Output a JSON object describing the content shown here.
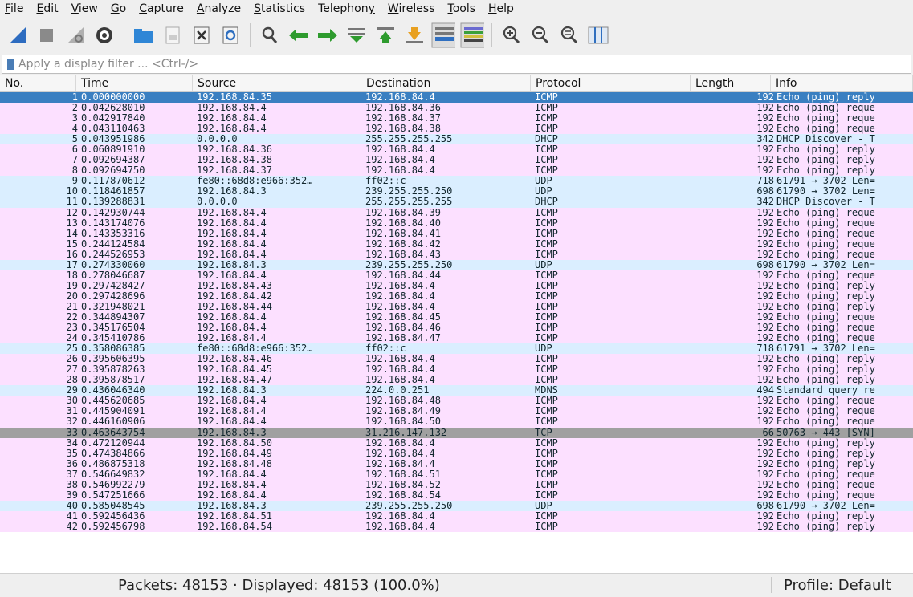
{
  "menu": [
    "File",
    "Edit",
    "View",
    "Go",
    "Capture",
    "Analyze",
    "Statistics",
    "Telephony",
    "Wireless",
    "Tools",
    "Help"
  ],
  "toolbar_icons": [
    "shark-fin-start-icon",
    "stop-square-icon",
    "restart-fin-icon",
    "gear-options-icon",
    "open-folder-icon",
    "file-icon",
    "close-file-icon",
    "reload-icon",
    "search-icon",
    "arrow-back-icon",
    "arrow-forward-icon",
    "go-to-packet-icon",
    "first-packet-icon",
    "last-packet-icon",
    "autoscroll-icon",
    "colorize-icon",
    "zoom-in-icon",
    "zoom-out-icon",
    "zoom-normal-icon",
    "resize-columns-icon"
  ],
  "filter": {
    "placeholder": "Apply a display filter ... <Ctrl-/>"
  },
  "columns": [
    "No.",
    "Time",
    "Source",
    "Destination",
    "Protocol",
    "Length",
    "Info"
  ],
  "colors": {
    "icmp": "#fce0ff",
    "udp": "#daeeff",
    "tcp": "#a0a0a0",
    "selected": "#3a7fc1"
  },
  "packets": [
    [
      "1",
      "0.000000000",
      "192.168.84.35",
      "192.168.84.4",
      "ICMP",
      "192",
      "Echo (ping) reply"
    ],
    [
      "2",
      "0.042628010",
      "192.168.84.4",
      "192.168.84.36",
      "ICMP",
      "192",
      "Echo (ping) reque"
    ],
    [
      "3",
      "0.042917840",
      "192.168.84.4",
      "192.168.84.37",
      "ICMP",
      "192",
      "Echo (ping) reque"
    ],
    [
      "4",
      "0.043110463",
      "192.168.84.4",
      "192.168.84.38",
      "ICMP",
      "192",
      "Echo (ping) reque"
    ],
    [
      "5",
      "0.043951986",
      "0.0.0.0",
      "255.255.255.255",
      "DHCP",
      "342",
      "DHCP Discover - T"
    ],
    [
      "6",
      "0.060891910",
      "192.168.84.36",
      "192.168.84.4",
      "ICMP",
      "192",
      "Echo (ping) reply"
    ],
    [
      "7",
      "0.092694387",
      "192.168.84.38",
      "192.168.84.4",
      "ICMP",
      "192",
      "Echo (ping) reply"
    ],
    [
      "8",
      "0.092694750",
      "192.168.84.37",
      "192.168.84.4",
      "ICMP",
      "192",
      "Echo (ping) reply"
    ],
    [
      "9",
      "0.117870612",
      "fe80::68d8:e966:352…",
      "ff02::c",
      "UDP",
      "718",
      "61791 → 3702 Len="
    ],
    [
      "10",
      "0.118461857",
      "192.168.84.3",
      "239.255.255.250",
      "UDP",
      "698",
      "61790 → 3702 Len="
    ],
    [
      "11",
      "0.139288831",
      "0.0.0.0",
      "255.255.255.255",
      "DHCP",
      "342",
      "DHCP Discover - T"
    ],
    [
      "12",
      "0.142930744",
      "192.168.84.4",
      "192.168.84.39",
      "ICMP",
      "192",
      "Echo (ping) reque"
    ],
    [
      "13",
      "0.143174076",
      "192.168.84.4",
      "192.168.84.40",
      "ICMP",
      "192",
      "Echo (ping) reque"
    ],
    [
      "14",
      "0.143353316",
      "192.168.84.4",
      "192.168.84.41",
      "ICMP",
      "192",
      "Echo (ping) reque"
    ],
    [
      "15",
      "0.244124584",
      "192.168.84.4",
      "192.168.84.42",
      "ICMP",
      "192",
      "Echo (ping) reque"
    ],
    [
      "16",
      "0.244526953",
      "192.168.84.4",
      "192.168.84.43",
      "ICMP",
      "192",
      "Echo (ping) reque"
    ],
    [
      "17",
      "0.274330060",
      "192.168.84.3",
      "239.255.255.250",
      "UDP",
      "698",
      "61790 → 3702 Len="
    ],
    [
      "18",
      "0.278046687",
      "192.168.84.4",
      "192.168.84.44",
      "ICMP",
      "192",
      "Echo (ping) reque"
    ],
    [
      "19",
      "0.297428427",
      "192.168.84.43",
      "192.168.84.4",
      "ICMP",
      "192",
      "Echo (ping) reply"
    ],
    [
      "20",
      "0.297428696",
      "192.168.84.42",
      "192.168.84.4",
      "ICMP",
      "192",
      "Echo (ping) reply"
    ],
    [
      "21",
      "0.321948021",
      "192.168.84.44",
      "192.168.84.4",
      "ICMP",
      "192",
      "Echo (ping) reply"
    ],
    [
      "22",
      "0.344894307",
      "192.168.84.4",
      "192.168.84.45",
      "ICMP",
      "192",
      "Echo (ping) reque"
    ],
    [
      "23",
      "0.345176504",
      "192.168.84.4",
      "192.168.84.46",
      "ICMP",
      "192",
      "Echo (ping) reque"
    ],
    [
      "24",
      "0.345410786",
      "192.168.84.4",
      "192.168.84.47",
      "ICMP",
      "192",
      "Echo (ping) reque"
    ],
    [
      "25",
      "0.358086385",
      "fe80::68d8:e966:352…",
      "ff02::c",
      "UDP",
      "718",
      "61791 → 3702 Len="
    ],
    [
      "26",
      "0.395606395",
      "192.168.84.46",
      "192.168.84.4",
      "ICMP",
      "192",
      "Echo (ping) reply"
    ],
    [
      "27",
      "0.395878263",
      "192.168.84.45",
      "192.168.84.4",
      "ICMP",
      "192",
      "Echo (ping) reply"
    ],
    [
      "28",
      "0.395878517",
      "192.168.84.47",
      "192.168.84.4",
      "ICMP",
      "192",
      "Echo (ping) reply"
    ],
    [
      "29",
      "0.436046340",
      "192.168.84.3",
      "224.0.0.251",
      "MDNS",
      "494",
      "Standard query re"
    ],
    [
      "30",
      "0.445620685",
      "192.168.84.4",
      "192.168.84.48",
      "ICMP",
      "192",
      "Echo (ping) reque"
    ],
    [
      "31",
      "0.445904091",
      "192.168.84.4",
      "192.168.84.49",
      "ICMP",
      "192",
      "Echo (ping) reque"
    ],
    [
      "32",
      "0.446160906",
      "192.168.84.4",
      "192.168.84.50",
      "ICMP",
      "192",
      "Echo (ping) reque"
    ],
    [
      "33",
      "0.463643754",
      "192.168.84.3",
      "31.216.147.132",
      "TCP",
      "66",
      "50763 → 443 [SYN]"
    ],
    [
      "34",
      "0.472120944",
      "192.168.84.50",
      "192.168.84.4",
      "ICMP",
      "192",
      "Echo (ping) reply"
    ],
    [
      "35",
      "0.474384866",
      "192.168.84.49",
      "192.168.84.4",
      "ICMP",
      "192",
      "Echo (ping) reply"
    ],
    [
      "36",
      "0.486875318",
      "192.168.84.48",
      "192.168.84.4",
      "ICMP",
      "192",
      "Echo (ping) reply"
    ],
    [
      "37",
      "0.546649832",
      "192.168.84.4",
      "192.168.84.51",
      "ICMP",
      "192",
      "Echo (ping) reque"
    ],
    [
      "38",
      "0.546992279",
      "192.168.84.4",
      "192.168.84.52",
      "ICMP",
      "192",
      "Echo (ping) reque"
    ],
    [
      "39",
      "0.547251666",
      "192.168.84.4",
      "192.168.84.54",
      "ICMP",
      "192",
      "Echo (ping) reque"
    ],
    [
      "40",
      "0.585048545",
      "192.168.84.3",
      "239.255.255.250",
      "UDP",
      "698",
      "61790 → 3702 Len="
    ],
    [
      "41",
      "0.592456436",
      "192.168.84.51",
      "192.168.84.4",
      "ICMP",
      "192",
      "Echo (ping) reply"
    ],
    [
      "42",
      "0.592456798",
      "192.168.84.54",
      "192.168.84.4",
      "ICMP",
      "192",
      "Echo (ping) reply"
    ]
  ],
  "status": {
    "packets": "Packets: 48153 · Displayed: 48153 (100.0%)",
    "profile": "Profile: Default"
  }
}
